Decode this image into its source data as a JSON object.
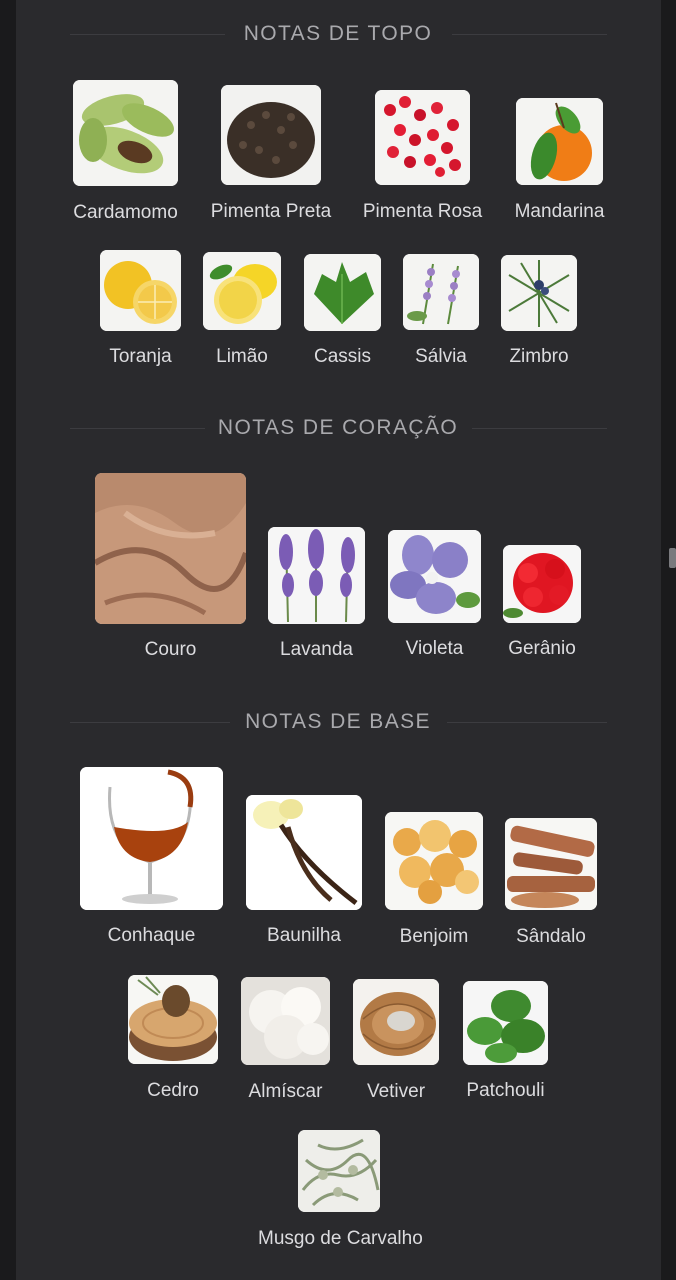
{
  "sections": {
    "top": {
      "title": "NOTAS DE TOPO",
      "notes": [
        "Cardamomo",
        "Pimenta Preta",
        "Pimenta Rosa",
        "Mandarina",
        "Toranja",
        "Limão",
        "Cassis",
        "Sálvia",
        "Zimbro"
      ]
    },
    "heart": {
      "title": "NOTAS DE CORAÇÃO",
      "notes": [
        "Couro",
        "Lavanda",
        "Violeta",
        "Gerânio"
      ]
    },
    "base": {
      "title": "NOTAS DE BASE",
      "notes": [
        "Conhaque",
        "Baunilha",
        "Benjoim",
        "Sândalo",
        "Cedro",
        "Almíscar",
        "Vetiver",
        "Patchouli",
        "Musgo de Carvalho"
      ]
    }
  },
  "icons": {
    "cardamom": "cardamom-pods-image",
    "black-pepper": "black-pepper-image",
    "pink-pepper": "pink-pepper-image",
    "mandarin": "mandarin-image",
    "grapefruit": "grapefruit-image",
    "lemon": "lemon-image",
    "blackcurrant-leaf": "cassis-leaf-image",
    "sage": "sage-image",
    "juniper": "juniper-image",
    "leather": "leather-image",
    "lavender": "lavender-image",
    "violet": "violet-image",
    "geranium": "geranium-image",
    "cognac": "cognac-glass-image",
    "vanilla": "vanilla-image",
    "benzoin": "benzoin-resin-image",
    "sandalwood": "sandalwood-image",
    "cedar": "cedar-log-image",
    "musk": "cotton-musk-image",
    "vetiver": "vetiver-roots-image",
    "patchouli": "patchouli-leaves-image",
    "oakmoss": "oakmoss-image"
  },
  "colors": {
    "background": "#2a2a2d",
    "heading": "#a9a9ad",
    "label": "#dcdcdf"
  }
}
